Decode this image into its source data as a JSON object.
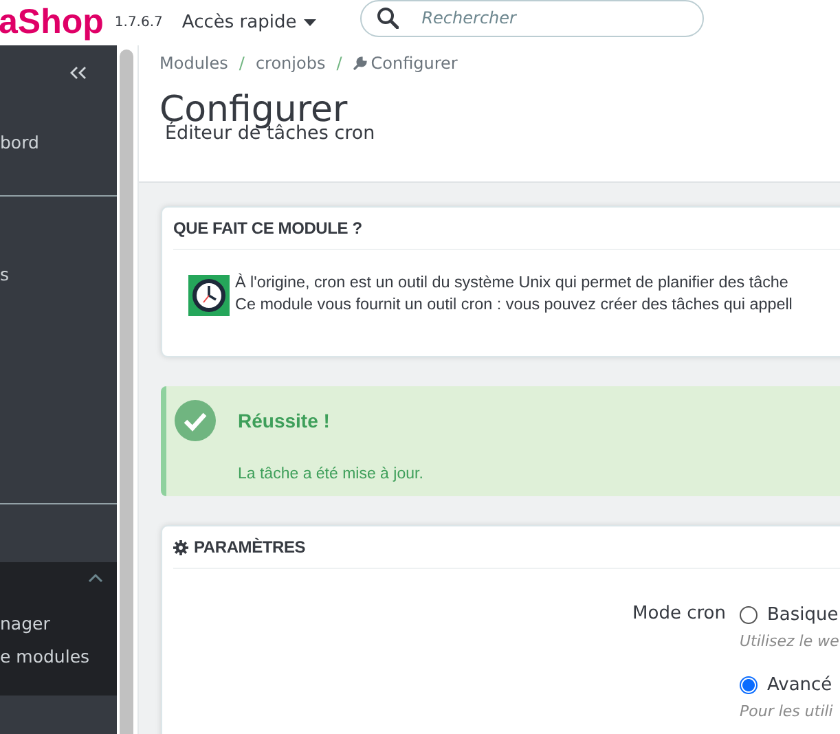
{
  "header": {
    "logo": "aShop",
    "version": "1.7.6.7",
    "quick_access": "Accès rapide",
    "search": {
      "placeholder": "Rechercher"
    }
  },
  "sidebar": {
    "items": [
      {
        "label": "bord"
      },
      {
        "label": "s"
      }
    ],
    "section": {
      "expanded": true,
      "children": [
        {
          "label": "nager"
        },
        {
          "label": "e modules"
        }
      ]
    }
  },
  "breadcrumb": {
    "separator": "/",
    "items": [
      "Modules",
      "cronjobs",
      "Configurer"
    ]
  },
  "page": {
    "title": "Configurer",
    "subtitle": "Éditeur de tâches cron"
  },
  "info_panel": {
    "heading": "QUE FAIT CE MODULE ?",
    "lines": [
      "À l'origine, cron est un outil du système Unix qui permet de planifier des tâche",
      "Ce module vous fournit un outil cron : vous pouvez créer des tâches qui appell"
    ]
  },
  "alert": {
    "kind": "success",
    "title": "Réussite !",
    "message": "La tâche a été mise à jour."
  },
  "settings_panel": {
    "heading": "PARAMÈTRES",
    "field": {
      "label": "Mode cron",
      "options": [
        {
          "label": "Basique",
          "help": "Utilisez le we",
          "selected": false
        },
        {
          "label": "Avancé",
          "help": "Pour les utili",
          "selected": true
        }
      ]
    }
  }
}
